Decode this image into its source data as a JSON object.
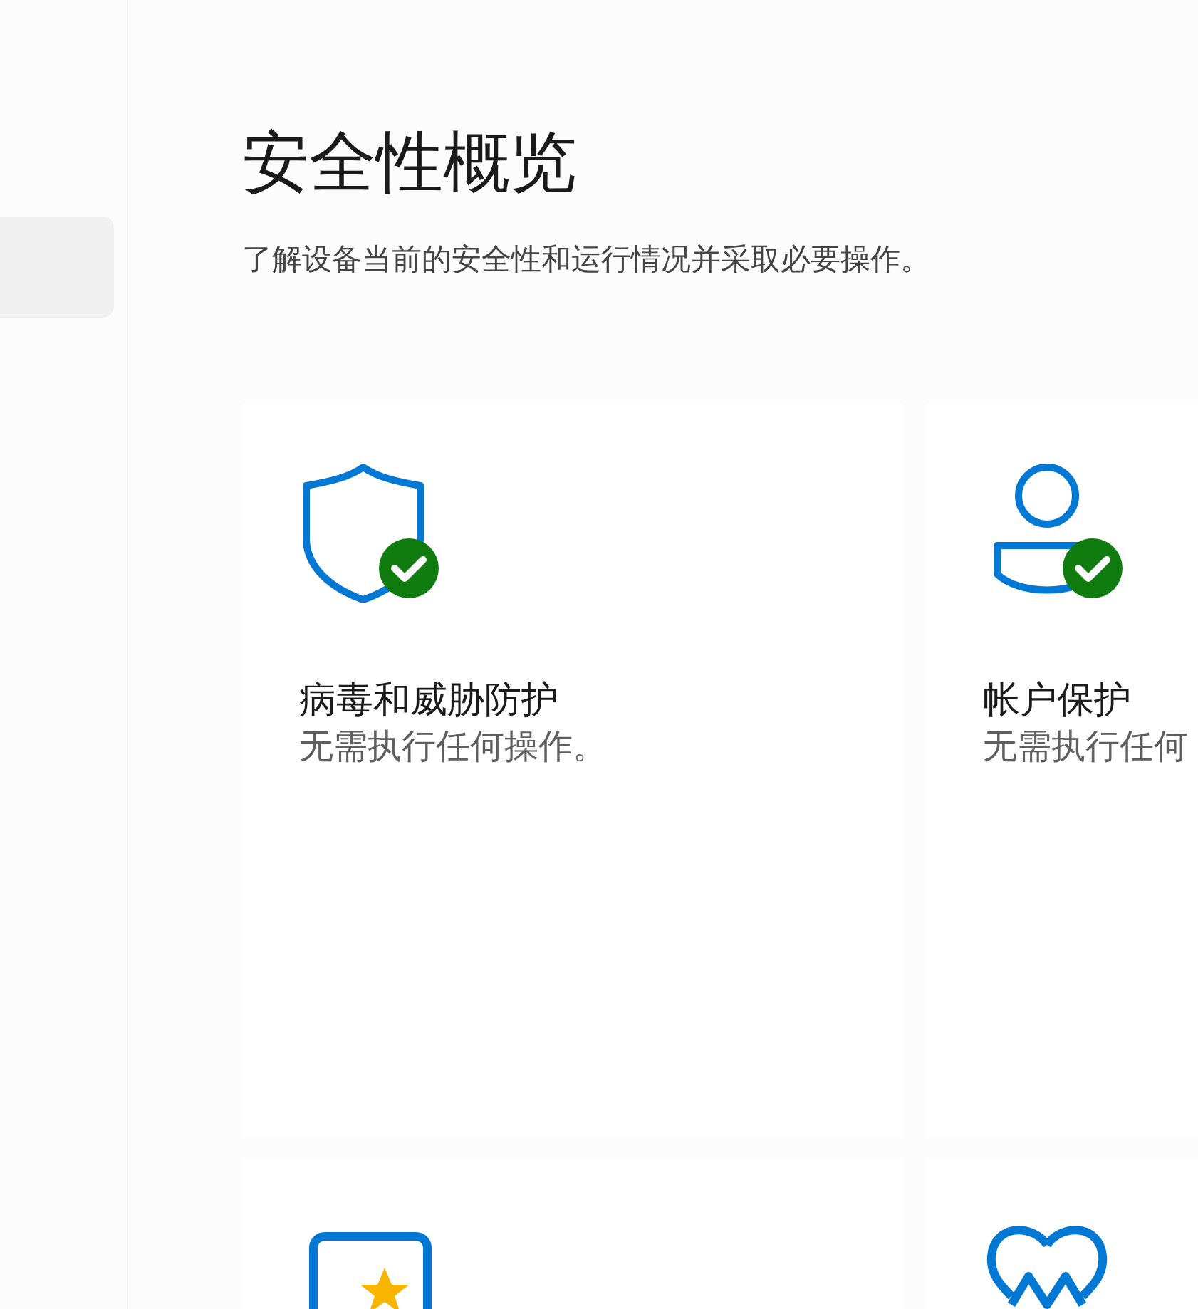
{
  "sidebar": {
    "items": [
      {
        "selected": true
      }
    ]
  },
  "title": "安全性概览",
  "subtitle": "了解设备当前的安全性和运行情况并采取必要操作。",
  "cards": [
    {
      "kind": "shield",
      "checked": true,
      "title": "病毒和威胁防护",
      "detail": "无需执行任何操作。"
    },
    {
      "kind": "account",
      "checked": true,
      "title": "帐户保护",
      "detail": "无需执行任何"
    },
    {
      "kind": "app"
    },
    {
      "kind": "health"
    }
  ]
}
